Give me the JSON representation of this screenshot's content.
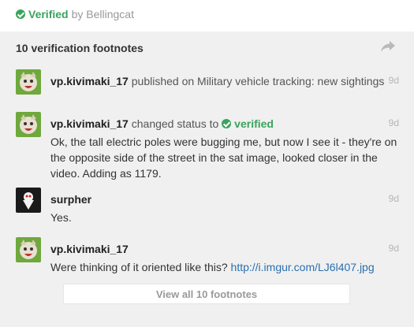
{
  "header": {
    "verified_label": "Verified",
    "by_text": "by Bellingcat",
    "status_color": "#3aa35c"
  },
  "panel": {
    "title": "10 verification footnotes",
    "share_icon": "share-icon",
    "view_all_label": "View all 10 footnotes"
  },
  "footnotes": [
    {
      "user": "vp.kivimaki_17",
      "action": "published on Military vehicle tracking: new sightings",
      "time": "9d",
      "avatar": "cat-avatar"
    },
    {
      "user": "vp.kivimaki_17",
      "action": "changed status to",
      "status": "verified",
      "time": "9d",
      "body": "Ok, the tall electric poles were bugging me, but now I see it - they're on the opposite side of the street in the sat image, looked closer in the video. Adding as 1179.",
      "avatar": "cat-avatar"
    },
    {
      "user": "surpher",
      "time": "9d",
      "body": "Yes.",
      "avatar": "dark-avatar"
    },
    {
      "user": "vp.kivimaki_17",
      "time": "9d",
      "body": "Were thinking of it oriented like this?",
      "link": "http://i.imgur.com/LJ6l407.jpg",
      "avatar": "cat-avatar"
    }
  ]
}
